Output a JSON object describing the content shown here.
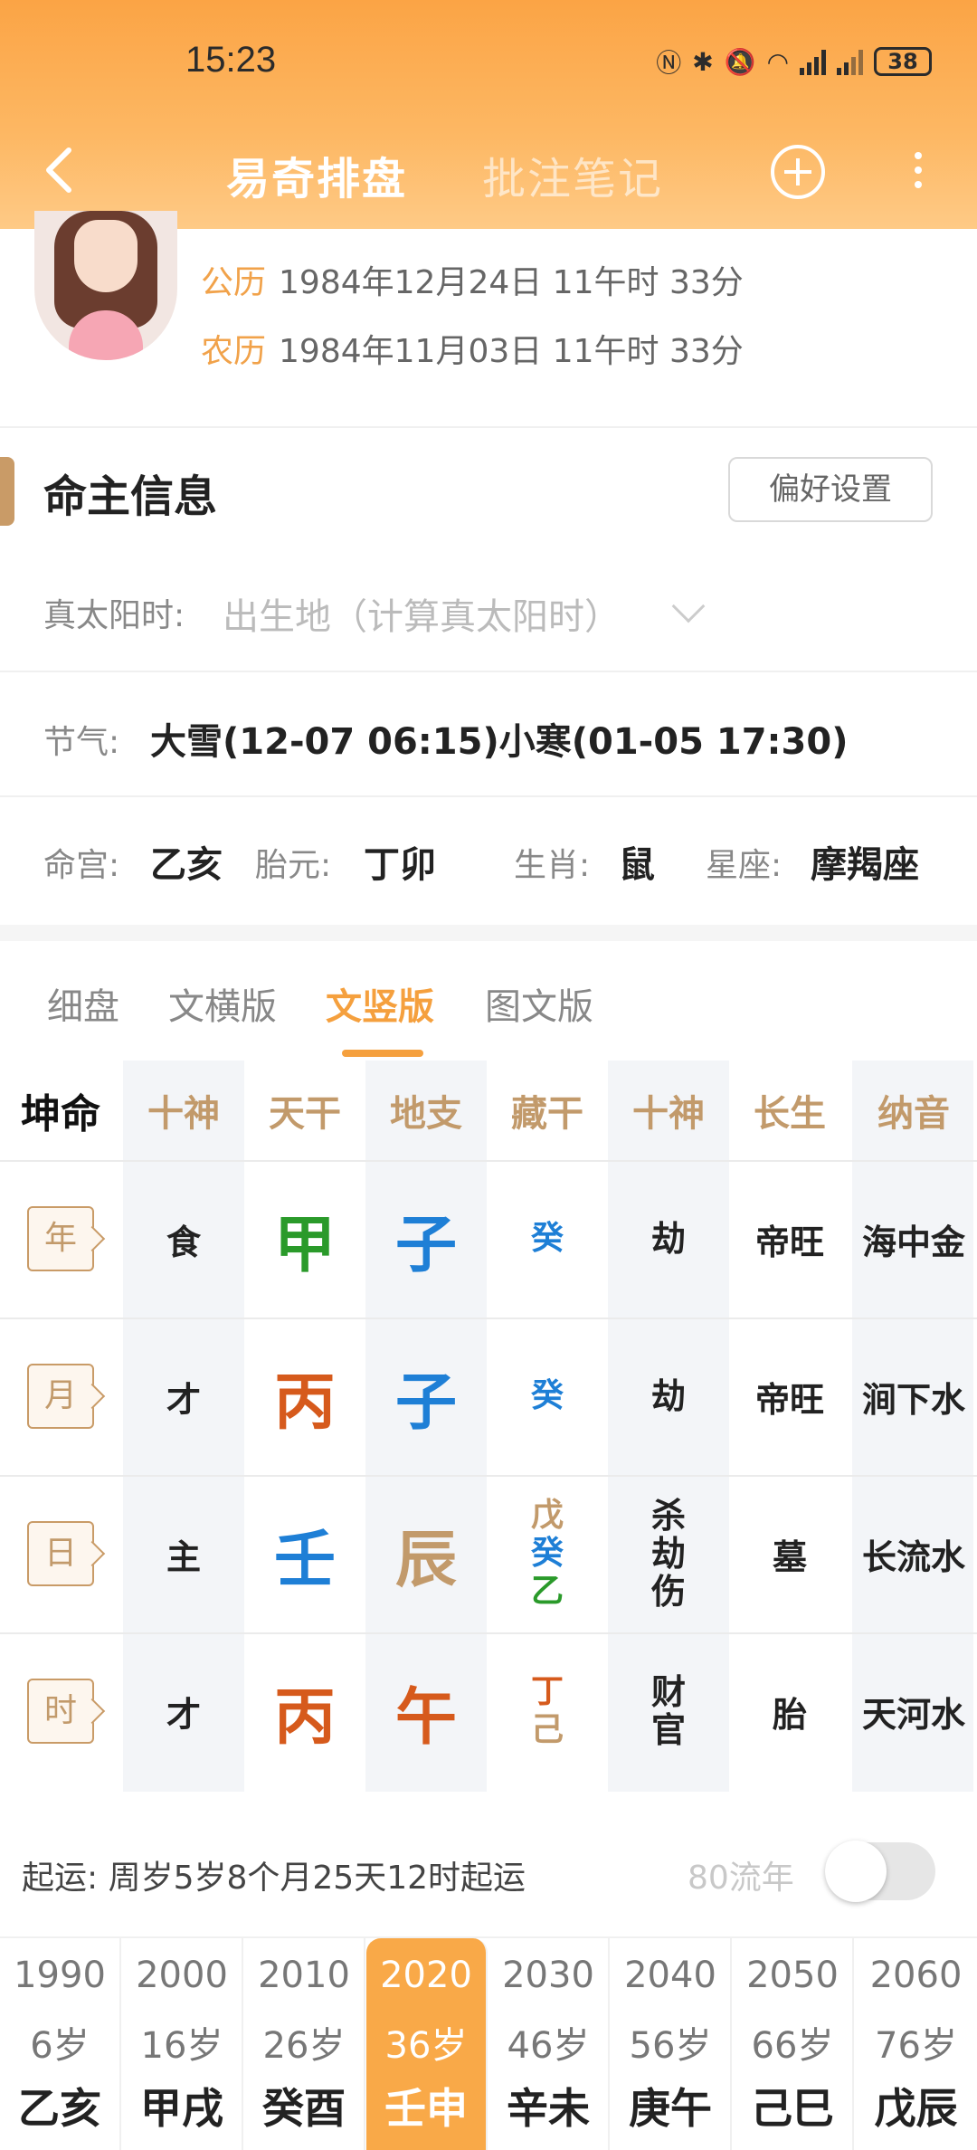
{
  "status_bar": {
    "time": "15:23",
    "battery": "38"
  },
  "nav": {
    "title_active": "易奇排盘",
    "title_inactive": "批注笔记"
  },
  "dates": {
    "solar_label": "公历",
    "solar_value": "1984年12月24日 11午时 33分",
    "lunar_label": "农历",
    "lunar_value": "1984年11月03日 11午时 33分"
  },
  "info": {
    "title": "命主信息",
    "pref_button": "偏好设置",
    "true_solar_label": "真太阳时:",
    "true_solar_placeholder": "出生地（计算真太阳时）",
    "jieqi_label": "节气:",
    "jieqi_value": "大雪(12-07 06:15)小寒(01-05 17:30)",
    "minggong_label": "命宫:",
    "minggong_value": "乙亥",
    "taiyuan_label": "胎元:",
    "taiyuan_value": "丁卯",
    "shengxiao_label": "生肖:",
    "shengxiao_value": "鼠",
    "xingzuo_label": "星座:",
    "xingzuo_value": "摩羯座"
  },
  "tabs": [
    "细盘",
    "文横版",
    "文竖版",
    "图文版"
  ],
  "tabs_active": "文竖版",
  "grid": {
    "corner": "坤命",
    "headers": [
      "十神",
      "天干",
      "地支",
      "藏干",
      "十神",
      "长生",
      "纳音"
    ],
    "rows": [
      {
        "pillar": "年",
        "shishen": "食",
        "gan": "甲",
        "gan_color": "#2a9a2a",
        "zhi": "子",
        "zhi_color": "#1e7fd6",
        "cang": [
          "癸"
        ],
        "cang_colors": [
          "#1e7fd6"
        ],
        "shishen2": [
          "劫"
        ],
        "changsheng": "帝旺",
        "nayin": "海中金"
      },
      {
        "pillar": "月",
        "shishen": "才",
        "gan": "丙",
        "gan_color": "#d65a1c",
        "zhi": "子",
        "zhi_color": "#1e7fd6",
        "cang": [
          "癸"
        ],
        "cang_colors": [
          "#1e7fd6"
        ],
        "shishen2": [
          "劫"
        ],
        "changsheng": "帝旺",
        "nayin": "涧下水"
      },
      {
        "pillar": "日",
        "shishen": "主",
        "gan": "壬",
        "gan_color": "#1e7fd6",
        "zhi": "辰",
        "zhi_color": "#c29a6b",
        "cang": [
          "戊",
          "癸",
          "乙"
        ],
        "cang_colors": [
          "#c29a6b",
          "#1e7fd6",
          "#2a9a2a"
        ],
        "shishen2": [
          "杀",
          "劫",
          "伤"
        ],
        "changsheng": "墓",
        "nayin": "长流水"
      },
      {
        "pillar": "时",
        "shishen": "才",
        "gan": "丙",
        "gan_color": "#d65a1c",
        "zhi": "午",
        "zhi_color": "#d65a1c",
        "cang": [
          "丁",
          "己"
        ],
        "cang_colors": [
          "#d65a1c",
          "#c29a6b"
        ],
        "shishen2": [
          "财",
          "官"
        ],
        "changsheng": "胎",
        "nayin": "天河水"
      }
    ]
  },
  "luck": {
    "start_text": "起运:  周岁5岁8个月25天12时起运",
    "flow_label": "80流年",
    "decades": [
      {
        "year": "1990",
        "age": "6岁",
        "gz": "乙亥"
      },
      {
        "year": "2000",
        "age": "16岁",
        "gz": "甲戌"
      },
      {
        "year": "2010",
        "age": "26岁",
        "gz": "癸酉"
      },
      {
        "year": "2020",
        "age": "36岁",
        "gz": "壬申"
      },
      {
        "year": "2030",
        "age": "46岁",
        "gz": "辛未"
      },
      {
        "year": "2040",
        "age": "56岁",
        "gz": "庚午"
      },
      {
        "year": "2050",
        "age": "66岁",
        "gz": "己巳"
      },
      {
        "year": "2060",
        "age": "76岁",
        "gz": "戊辰"
      }
    ],
    "active_decade": "2020"
  }
}
